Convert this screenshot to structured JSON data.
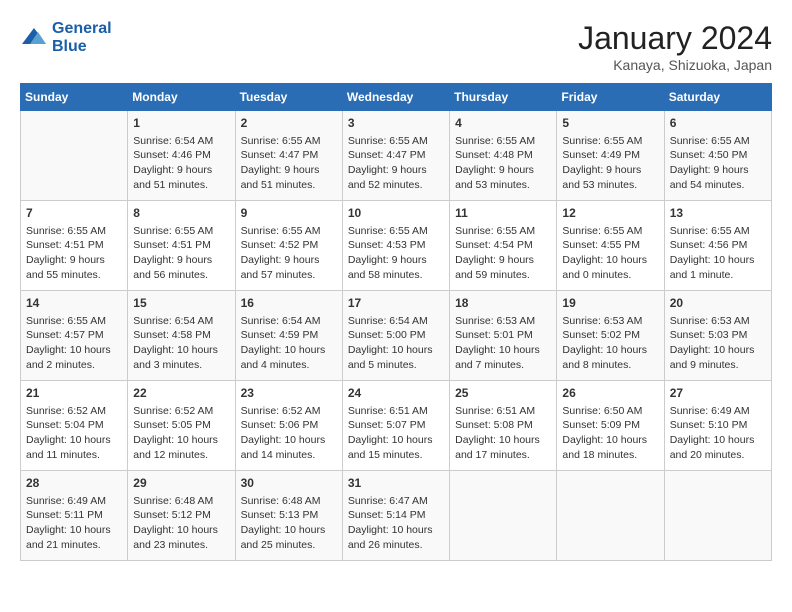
{
  "header": {
    "logo_line1": "General",
    "logo_line2": "Blue",
    "month_title": "January 2024",
    "location": "Kanaya, Shizuoka, Japan"
  },
  "days_of_week": [
    "Sunday",
    "Monday",
    "Tuesday",
    "Wednesday",
    "Thursday",
    "Friday",
    "Saturday"
  ],
  "weeks": [
    [
      {
        "day": "",
        "info": ""
      },
      {
        "day": "1",
        "info": "Sunrise: 6:54 AM\nSunset: 4:46 PM\nDaylight: 9 hours\nand 51 minutes."
      },
      {
        "day": "2",
        "info": "Sunrise: 6:55 AM\nSunset: 4:47 PM\nDaylight: 9 hours\nand 51 minutes."
      },
      {
        "day": "3",
        "info": "Sunrise: 6:55 AM\nSunset: 4:47 PM\nDaylight: 9 hours\nand 52 minutes."
      },
      {
        "day": "4",
        "info": "Sunrise: 6:55 AM\nSunset: 4:48 PM\nDaylight: 9 hours\nand 53 minutes."
      },
      {
        "day": "5",
        "info": "Sunrise: 6:55 AM\nSunset: 4:49 PM\nDaylight: 9 hours\nand 53 minutes."
      },
      {
        "day": "6",
        "info": "Sunrise: 6:55 AM\nSunset: 4:50 PM\nDaylight: 9 hours\nand 54 minutes."
      }
    ],
    [
      {
        "day": "7",
        "info": "Sunrise: 6:55 AM\nSunset: 4:51 PM\nDaylight: 9 hours\nand 55 minutes."
      },
      {
        "day": "8",
        "info": "Sunrise: 6:55 AM\nSunset: 4:51 PM\nDaylight: 9 hours\nand 56 minutes."
      },
      {
        "day": "9",
        "info": "Sunrise: 6:55 AM\nSunset: 4:52 PM\nDaylight: 9 hours\nand 57 minutes."
      },
      {
        "day": "10",
        "info": "Sunrise: 6:55 AM\nSunset: 4:53 PM\nDaylight: 9 hours\nand 58 minutes."
      },
      {
        "day": "11",
        "info": "Sunrise: 6:55 AM\nSunset: 4:54 PM\nDaylight: 9 hours\nand 59 minutes."
      },
      {
        "day": "12",
        "info": "Sunrise: 6:55 AM\nSunset: 4:55 PM\nDaylight: 10 hours\nand 0 minutes."
      },
      {
        "day": "13",
        "info": "Sunrise: 6:55 AM\nSunset: 4:56 PM\nDaylight: 10 hours\nand 1 minute."
      }
    ],
    [
      {
        "day": "14",
        "info": "Sunrise: 6:55 AM\nSunset: 4:57 PM\nDaylight: 10 hours\nand 2 minutes."
      },
      {
        "day": "15",
        "info": "Sunrise: 6:54 AM\nSunset: 4:58 PM\nDaylight: 10 hours\nand 3 minutes."
      },
      {
        "day": "16",
        "info": "Sunrise: 6:54 AM\nSunset: 4:59 PM\nDaylight: 10 hours\nand 4 minutes."
      },
      {
        "day": "17",
        "info": "Sunrise: 6:54 AM\nSunset: 5:00 PM\nDaylight: 10 hours\nand 5 minutes."
      },
      {
        "day": "18",
        "info": "Sunrise: 6:53 AM\nSunset: 5:01 PM\nDaylight: 10 hours\nand 7 minutes."
      },
      {
        "day": "19",
        "info": "Sunrise: 6:53 AM\nSunset: 5:02 PM\nDaylight: 10 hours\nand 8 minutes."
      },
      {
        "day": "20",
        "info": "Sunrise: 6:53 AM\nSunset: 5:03 PM\nDaylight: 10 hours\nand 9 minutes."
      }
    ],
    [
      {
        "day": "21",
        "info": "Sunrise: 6:52 AM\nSunset: 5:04 PM\nDaylight: 10 hours\nand 11 minutes."
      },
      {
        "day": "22",
        "info": "Sunrise: 6:52 AM\nSunset: 5:05 PM\nDaylight: 10 hours\nand 12 minutes."
      },
      {
        "day": "23",
        "info": "Sunrise: 6:52 AM\nSunset: 5:06 PM\nDaylight: 10 hours\nand 14 minutes."
      },
      {
        "day": "24",
        "info": "Sunrise: 6:51 AM\nSunset: 5:07 PM\nDaylight: 10 hours\nand 15 minutes."
      },
      {
        "day": "25",
        "info": "Sunrise: 6:51 AM\nSunset: 5:08 PM\nDaylight: 10 hours\nand 17 minutes."
      },
      {
        "day": "26",
        "info": "Sunrise: 6:50 AM\nSunset: 5:09 PM\nDaylight: 10 hours\nand 18 minutes."
      },
      {
        "day": "27",
        "info": "Sunrise: 6:49 AM\nSunset: 5:10 PM\nDaylight: 10 hours\nand 20 minutes."
      }
    ],
    [
      {
        "day": "28",
        "info": "Sunrise: 6:49 AM\nSunset: 5:11 PM\nDaylight: 10 hours\nand 21 minutes."
      },
      {
        "day": "29",
        "info": "Sunrise: 6:48 AM\nSunset: 5:12 PM\nDaylight: 10 hours\nand 23 minutes."
      },
      {
        "day": "30",
        "info": "Sunrise: 6:48 AM\nSunset: 5:13 PM\nDaylight: 10 hours\nand 25 minutes."
      },
      {
        "day": "31",
        "info": "Sunrise: 6:47 AM\nSunset: 5:14 PM\nDaylight: 10 hours\nand 26 minutes."
      },
      {
        "day": "",
        "info": ""
      },
      {
        "day": "",
        "info": ""
      },
      {
        "day": "",
        "info": ""
      }
    ]
  ]
}
